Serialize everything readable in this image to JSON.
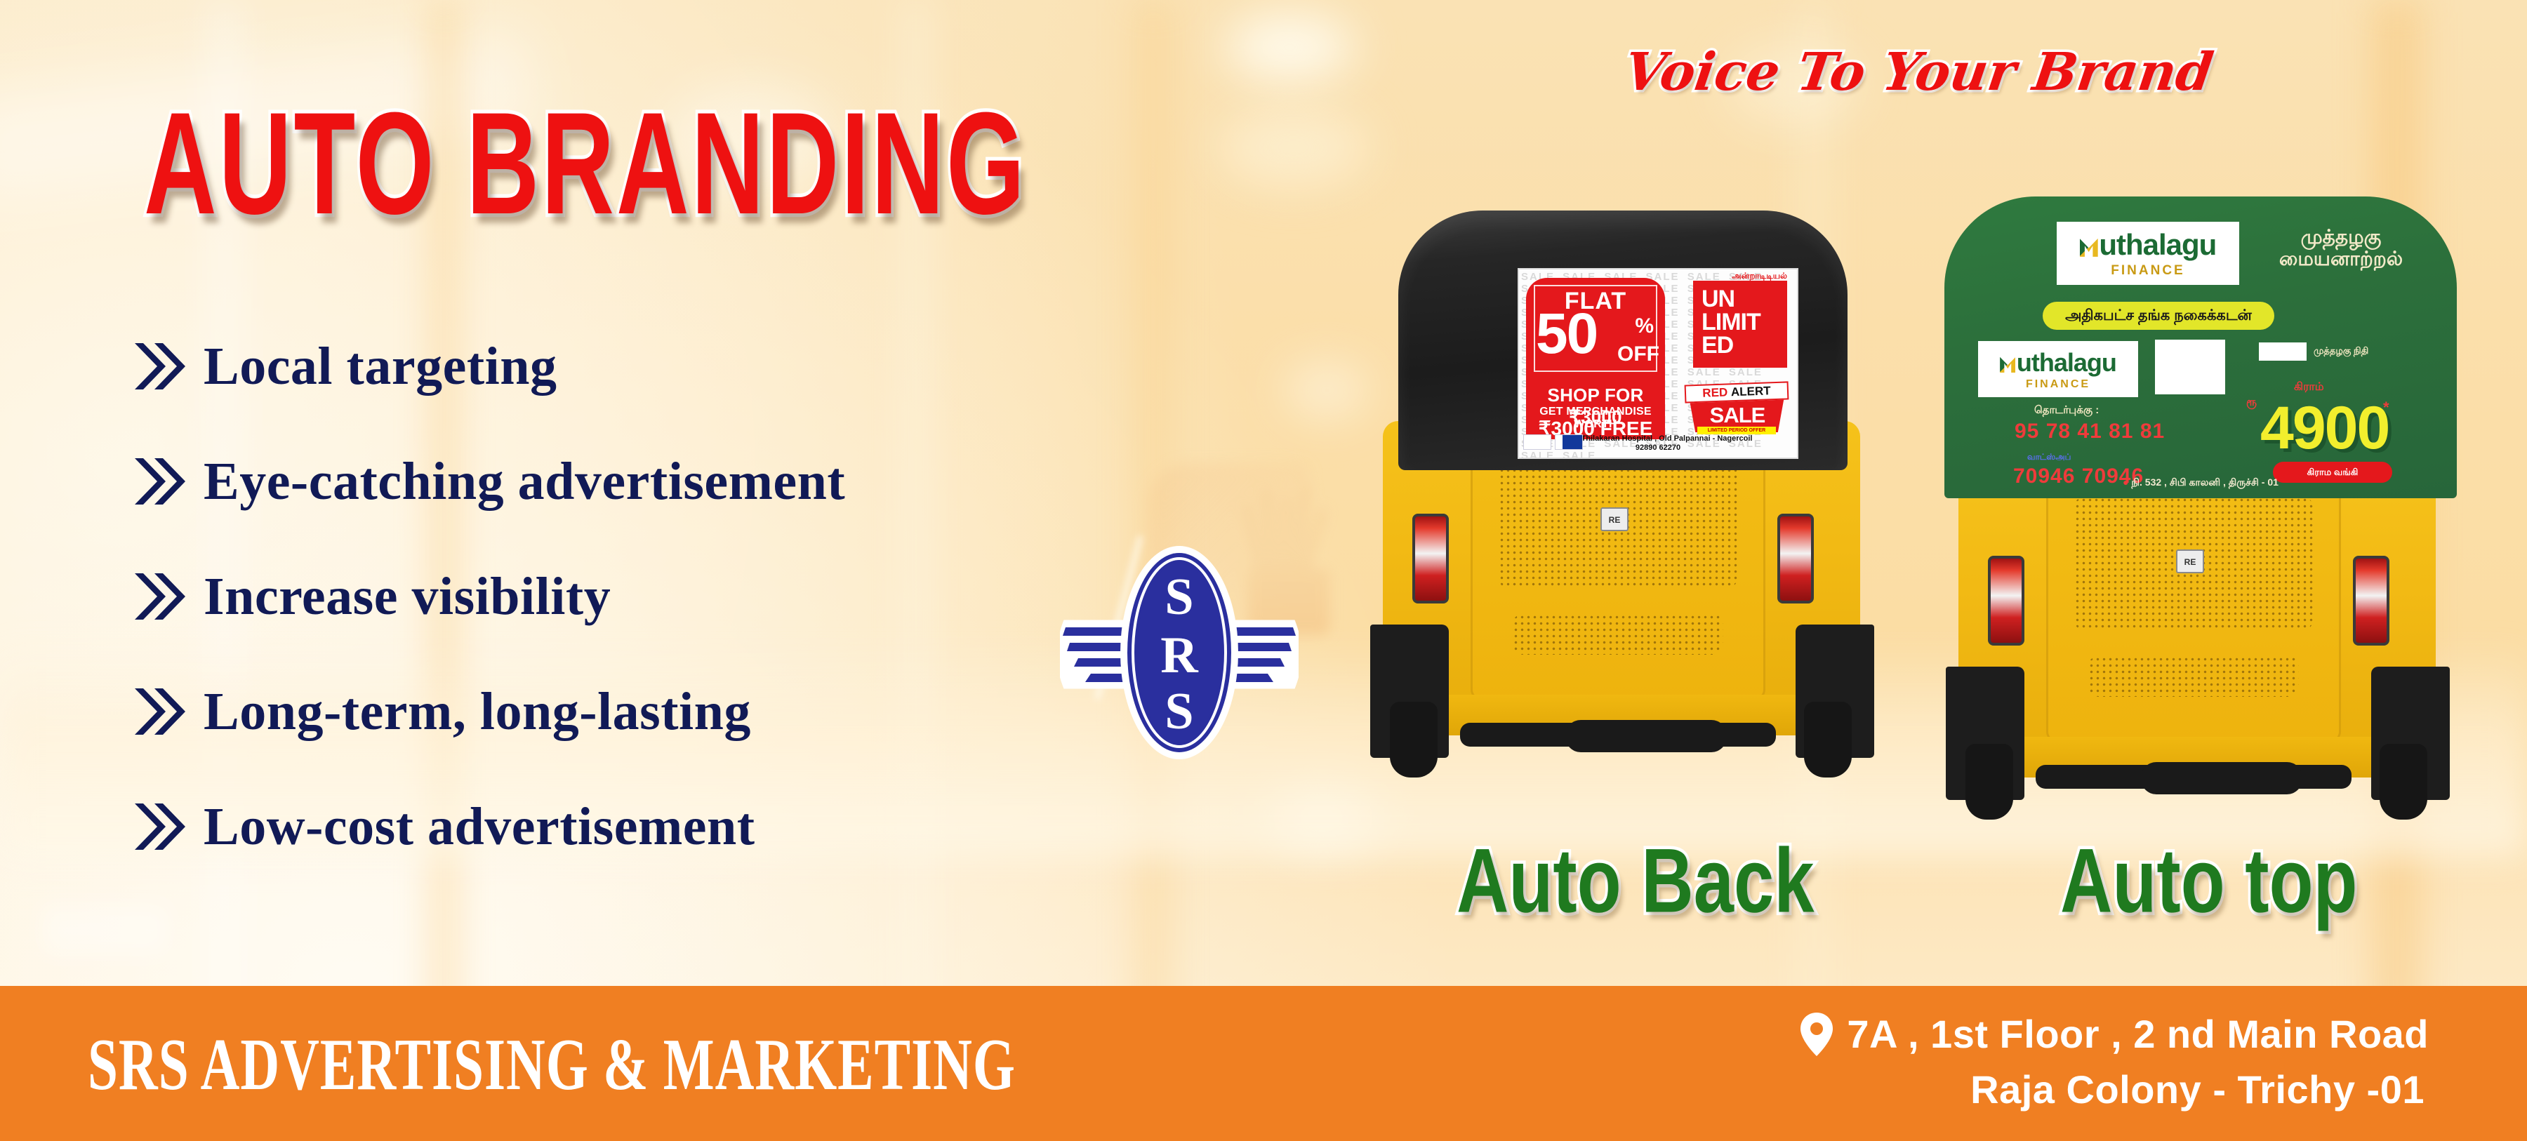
{
  "headline": "AUTO BRANDING",
  "tagline": "Voice To Your Brand",
  "brand": {
    "logo_letters": [
      "S",
      "R",
      "S"
    ],
    "logo_name": "srs-winged-badge",
    "navy": "#2a2f9e",
    "orange": "#f07f22",
    "red": "#ee1111",
    "green": "#1f7a1f"
  },
  "bullets": [
    {
      "text": "Local targeting"
    },
    {
      "text": "Eye-catching advertisement"
    },
    {
      "text": "Increase visibility"
    },
    {
      "text": "Long-term, long-lasting"
    },
    {
      "text": "Low-cost advertisement"
    }
  ],
  "autos": [
    {
      "caption": "Auto Back",
      "panel_type": "back-ad",
      "ad": {
        "flat_word": "FLAT",
        "discount": "50",
        "percent": "%",
        "off": "OFF",
        "shop_line": "SHOP FOR ₹3000",
        "get_line": "GET MERCHANDISE WORTH",
        "free_line": "₹3000 FREE",
        "unlimited": "UNLIMITED",
        "unlimited_lines": [
          "UN",
          "LIMIT",
          "ED"
        ],
        "tamil_top": "அன்றாடிடியல்",
        "red_alert": "RED",
        "alert": "ALERT",
        "sale": "SALE",
        "limited_offer": "LIMITED PERIOD OFFER",
        "address": "Opp.Thilakaran Hospital , Old Palpannai - Nagercoil",
        "phone": "92890 62270",
        "bg_word": "SALE"
      }
    },
    {
      "caption": "Auto top",
      "panel_type": "top-ad",
      "ad": {
        "brand_word": "uthalagu",
        "brand_sub": "FINANCE",
        "tamil_head": "முத்தழகு\nமையனாற்றல்",
        "yellow_band": "அதிகபட்ச தங்க நகைக்கடன்",
        "phone_label_1": "தொடர்புக்கு :",
        "phone_1": "95 78 41 81 81",
        "phone_label_2": "வாட்ஸ்அப்",
        "phone_2": "70946 70946",
        "price_label": "கிராம்",
        "price_prefix": "ரூ",
        "price": "4900",
        "price_star": "*",
        "red_pill": "கிராம வங்கி",
        "side_note": "முத்தழகு நிதி",
        "address": "நி. 532 , சிபி காலனி , திருச்சி - 01"
      }
    }
  ],
  "footer": {
    "company": "SRS ADVERTISING & MARKETING",
    "address_line_1": "7A , 1st Floor , 2 nd Main Road",
    "address_line_2": "Raja Colony - Trichy -01",
    "pin_icon": "map-pin-icon"
  }
}
